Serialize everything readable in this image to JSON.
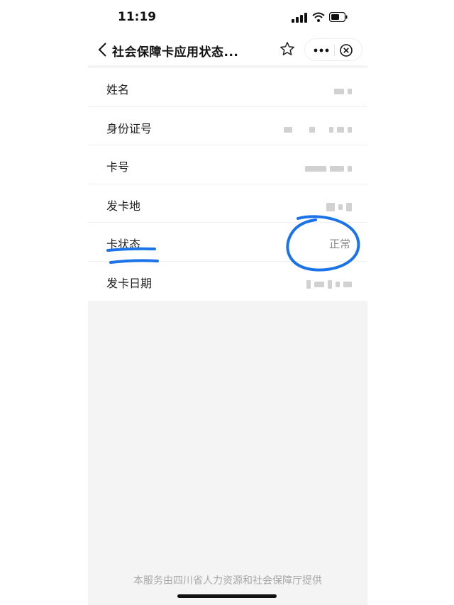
{
  "status_bar": {
    "time": "11:19"
  },
  "nav": {
    "title": "社会保障卡应用状态..."
  },
  "rows": [
    {
      "label": "姓名",
      "value": ""
    },
    {
      "label": "身份证号",
      "value": ""
    },
    {
      "label": "卡号",
      "value": ""
    },
    {
      "label": "发卡地",
      "value": ""
    },
    {
      "label": "卡状态",
      "value": "正常"
    },
    {
      "label": "发卡日期",
      "value": ""
    }
  ],
  "footer": {
    "text": "本服务由四川省人力资源和社会保障厅提供"
  },
  "annotation": {
    "color": "#1a73e8"
  },
  "icons": [
    "back-chevron-icon",
    "star-icon",
    "more-icon",
    "close-circle-icon",
    "signal-icon",
    "wifi-icon",
    "battery-icon"
  ]
}
